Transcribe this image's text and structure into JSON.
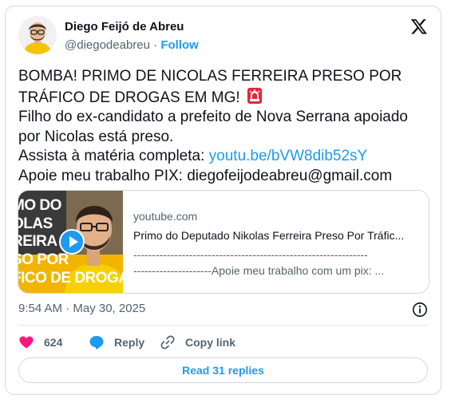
{
  "author": {
    "name": "Diego Feijó de Abreu",
    "handle": "@diegodeabreu",
    "separator": "·",
    "follow_label": "Follow"
  },
  "tweet": {
    "line1": "BOMBA! PRIMO DE NICOLAS FERREIRA PRESO POR",
    "line2": "TRÁFICO DE DROGAS EM MG!",
    "line3": "Filho do ex-candidato a prefeito de Nova Serrana apoiado",
    "line4": "por Nicolas está preso.",
    "line5_prefix": "Assista à matéria completa: ",
    "link_text": "youtu.be/bVW8dib52sY",
    "line6": "Apoie meu trabalho PIX: diegofeijodeabreu@gmail.com",
    "emoji_icon": "police-siren-icon"
  },
  "link_card": {
    "thumbnail_lines": [
      "MO DO",
      "OLAS",
      "REIRA",
      "SO POR",
      "FICO DE DROGA"
    ],
    "domain": "youtube.com",
    "title": "Primo do Deputado Nikolas Ferreira Preso Por Tráfic...",
    "desc_line1": "---------------------------------------------------------------",
    "desc_line2": "---------------------Apoie meu trabalho com um pix: ..."
  },
  "timestamp": "9:54 AM · May 30, 2025",
  "actions": {
    "like_count": "624",
    "reply_label": "Reply",
    "copy_label": "Copy link"
  },
  "read_replies_label": "Read 31 replies",
  "colors": {
    "accent": "#1d9bf0",
    "like": "#f91880",
    "text": "#0f1419",
    "muted": "#536471",
    "thumbnail_bg": "#f3b400"
  }
}
